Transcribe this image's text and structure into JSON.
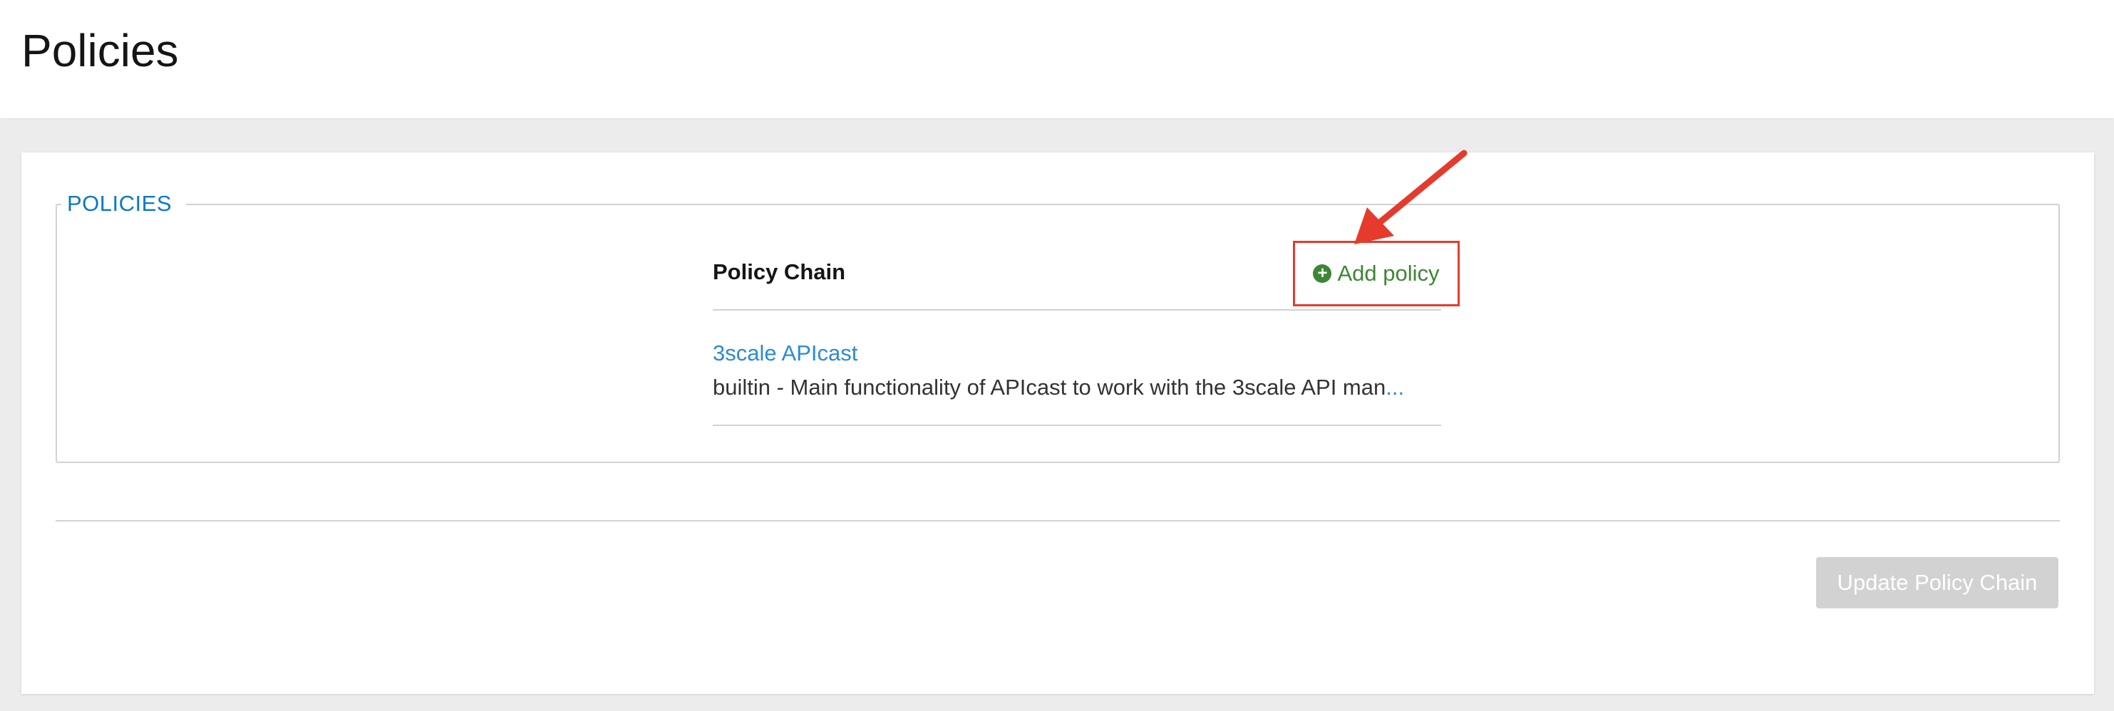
{
  "header": {
    "title": "Policies"
  },
  "policies_section": {
    "legend": "POLICIES",
    "chain_title": "Policy Chain",
    "add_policy_label": "Add policy",
    "items": [
      {
        "name": "3scale APIcast",
        "description": "builtin - Main functionality of APIcast to work with the 3scale API man",
        "ellipsis": "..."
      }
    ]
  },
  "footer": {
    "update_button_label": "Update Policy Chain"
  },
  "colors": {
    "legend": "#0a78c8",
    "add_policy": "#3e8635",
    "highlight_box": "#e53b2c",
    "link": "#2b8ad6",
    "disabled_button": "#d2d2d2"
  },
  "icons": {
    "add_policy": "plus-circle-icon",
    "annotation": "red-arrow-icon"
  }
}
